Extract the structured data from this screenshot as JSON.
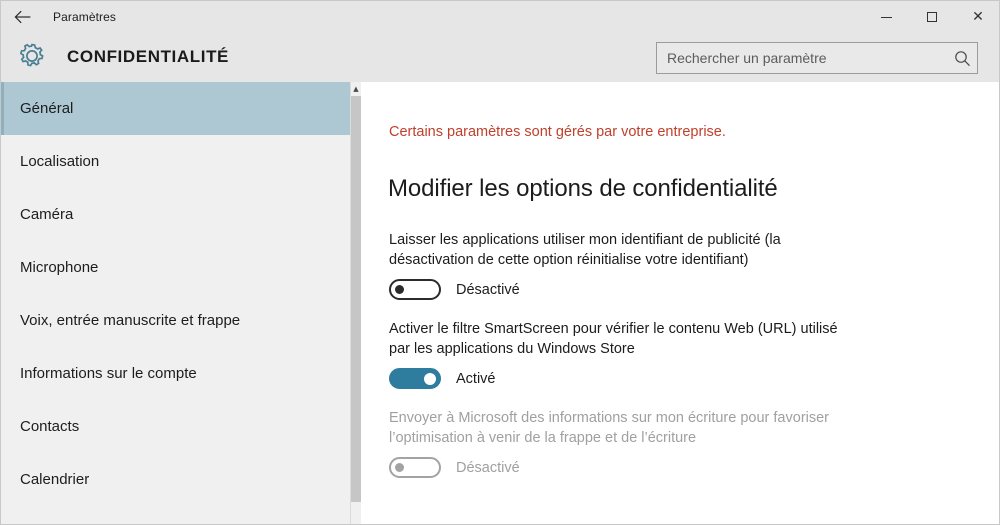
{
  "window": {
    "titlebar_title": "Paramètres",
    "back_icon": "back-arrow-icon",
    "minimize_label": "",
    "maximize_label": "",
    "close_label": "✕"
  },
  "header": {
    "icon": "gear-icon",
    "title": "CONFIDENTIALITÉ",
    "search": {
      "placeholder": "Rechercher un paramètre",
      "value": "",
      "icon": "search-icon"
    }
  },
  "sidebar": {
    "items": [
      {
        "label": "Général",
        "selected": true
      },
      {
        "label": "Localisation",
        "selected": false
      },
      {
        "label": "Caméra",
        "selected": false
      },
      {
        "label": "Microphone",
        "selected": false
      },
      {
        "label": "Voix, entrée manuscrite et frappe",
        "selected": false
      },
      {
        "label": "Informations sur le compte",
        "selected": false
      },
      {
        "label": "Contacts",
        "selected": false
      },
      {
        "label": "Calendrier",
        "selected": false
      }
    ],
    "scrollbar": {
      "up_arrow_icon": "chevron-up-icon"
    }
  },
  "main": {
    "enterprise_note": "Certains paramètres sont gérés par votre entreprise.",
    "heading": "Modifier les options de confidentialité",
    "settings": [
      {
        "label": "Laisser les applications utiliser mon identifiant de publicité (la désactivation de cette option réinitialise votre identifiant)",
        "state_label": "Désactivé",
        "state": "off",
        "disabled": false
      },
      {
        "label": "Activer le filtre SmartScreen pour vérifier le contenu Web (URL) utilisé par les applications du Windows Store",
        "state_label": "Activé",
        "state": "on",
        "disabled": false
      },
      {
        "label": "Envoyer à Microsoft des informations sur mon écriture pour favoriser l’optimisation à venir de la frappe et de l’écriture",
        "state_label": "Désactivé",
        "state": "off",
        "disabled": true
      }
    ]
  },
  "colors": {
    "accent_toggle_on": "#2f7d9e",
    "selected_nav": "#aec8d3",
    "warning_text": "#c0402b",
    "chrome_bg": "#e6e6e6",
    "sidebar_bg": "#f0f0f0"
  }
}
